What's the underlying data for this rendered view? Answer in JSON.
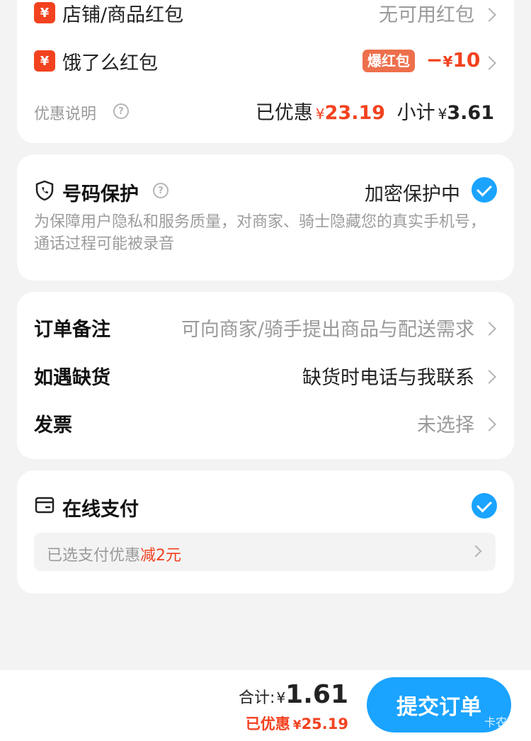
{
  "discounts": {
    "shop_item_label": "店铺/商品红包",
    "shop_item_value": "无可用红包",
    "eleme_label": "饿了么红包",
    "eleme_badge": "爆红包",
    "eleme_value_prefix": "−",
    "eleme_value_yen": "¥",
    "eleme_value_amount": "10",
    "yen_icon_glyph": "¥",
    "info_label": "优惠说明",
    "saved_label": "已优惠",
    "saved_yen": "¥",
    "saved_amount": "23.19",
    "subtotal_label": "小计",
    "subtotal_yen": "¥",
    "subtotal_amount": "3.61"
  },
  "privacy": {
    "title": "号码保护",
    "status": "加密保护中",
    "description": "为保障用户隐私和服务质量，对商家、骑士隐藏您的真实手机号，通话过程可能被录音",
    "checked": true
  },
  "order_options": [
    {
      "label": "订单备注",
      "value": "可向商家/骑手提出商品与配送需求",
      "value_style": "muted"
    },
    {
      "label": "如遇缺货",
      "value": "缺货时电话与我联系",
      "value_style": "normal"
    },
    {
      "label": "发票",
      "value": "未选择",
      "value_style": "muted"
    }
  ],
  "payment": {
    "title": "在线支付",
    "checked": true,
    "promo_prefix": "已选支付优惠",
    "promo_highlight": "减2元"
  },
  "footer": {
    "total_label": "合计:",
    "total_yen": "¥",
    "total_amount": "1.61",
    "saved_label": "已优惠",
    "saved_yen": "¥",
    "saved_amount": "25.19",
    "submit_label": "提交订单",
    "watermark": "卡农社区"
  },
  "colors": {
    "accent": "#1aa3ff",
    "discount_red": "#f2421f",
    "background": "#f3f3f3"
  },
  "icons": [
    "yen-icon",
    "chevron-right-icon",
    "question-mark-icon",
    "shield-phone-icon",
    "check-circle-icon",
    "wallet-icon"
  ]
}
